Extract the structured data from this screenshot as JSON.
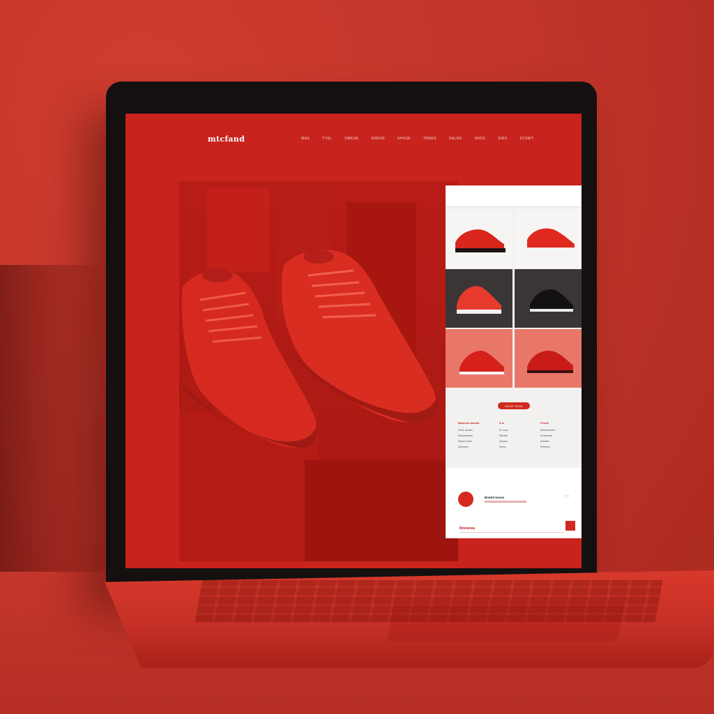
{
  "site": {
    "logo": "mtcfand",
    "nav": [
      "MAS",
      "TYSL",
      "SWKSE",
      "SHROS",
      "SHSSE",
      "TRNKS",
      "SALNS",
      "SHOS",
      "SIRS",
      "STOWT"
    ]
  },
  "product_grid": {
    "tiles": [
      {
        "name": "red-black-sneaker",
        "bg": "light"
      },
      {
        "name": "red-knit-sneaker",
        "bg": "light"
      },
      {
        "name": "red-white-high-top",
        "bg": "dark"
      },
      {
        "name": "black-sneaker",
        "bg": "dark"
      },
      {
        "name": "red-runner-sneaker",
        "bg": "salmon"
      },
      {
        "name": "red-dark-sneaker",
        "bg": "salmon"
      }
    ]
  },
  "cta_label": "SHOP NOW",
  "info_columns": [
    {
      "title": "Bnacess ausots",
      "lines": [
        "Seeis nicraks",
        "Seinemrsaed",
        "Hlenes trehe",
        "Seslmare"
      ]
    },
    {
      "title": "S ie",
      "lines": [
        "Ah sorrs",
        "Sterdes",
        "Sireass",
        "Svnes"
      ]
    },
    {
      "title": "Fesrts",
      "lines": [
        "Eaeenernerts",
        "Sroenienta",
        "Sstaieet",
        "Rreeioes"
      ]
    }
  ],
  "footer": {
    "title": "Bnehd wrues",
    "dots": "• •",
    "link": "Bmnanas"
  },
  "colors": {
    "brand_red": "#c8231c",
    "cta_red": "#d02a20",
    "dark_tile": "#3a3636",
    "salmon_tile": "#e8776a"
  }
}
